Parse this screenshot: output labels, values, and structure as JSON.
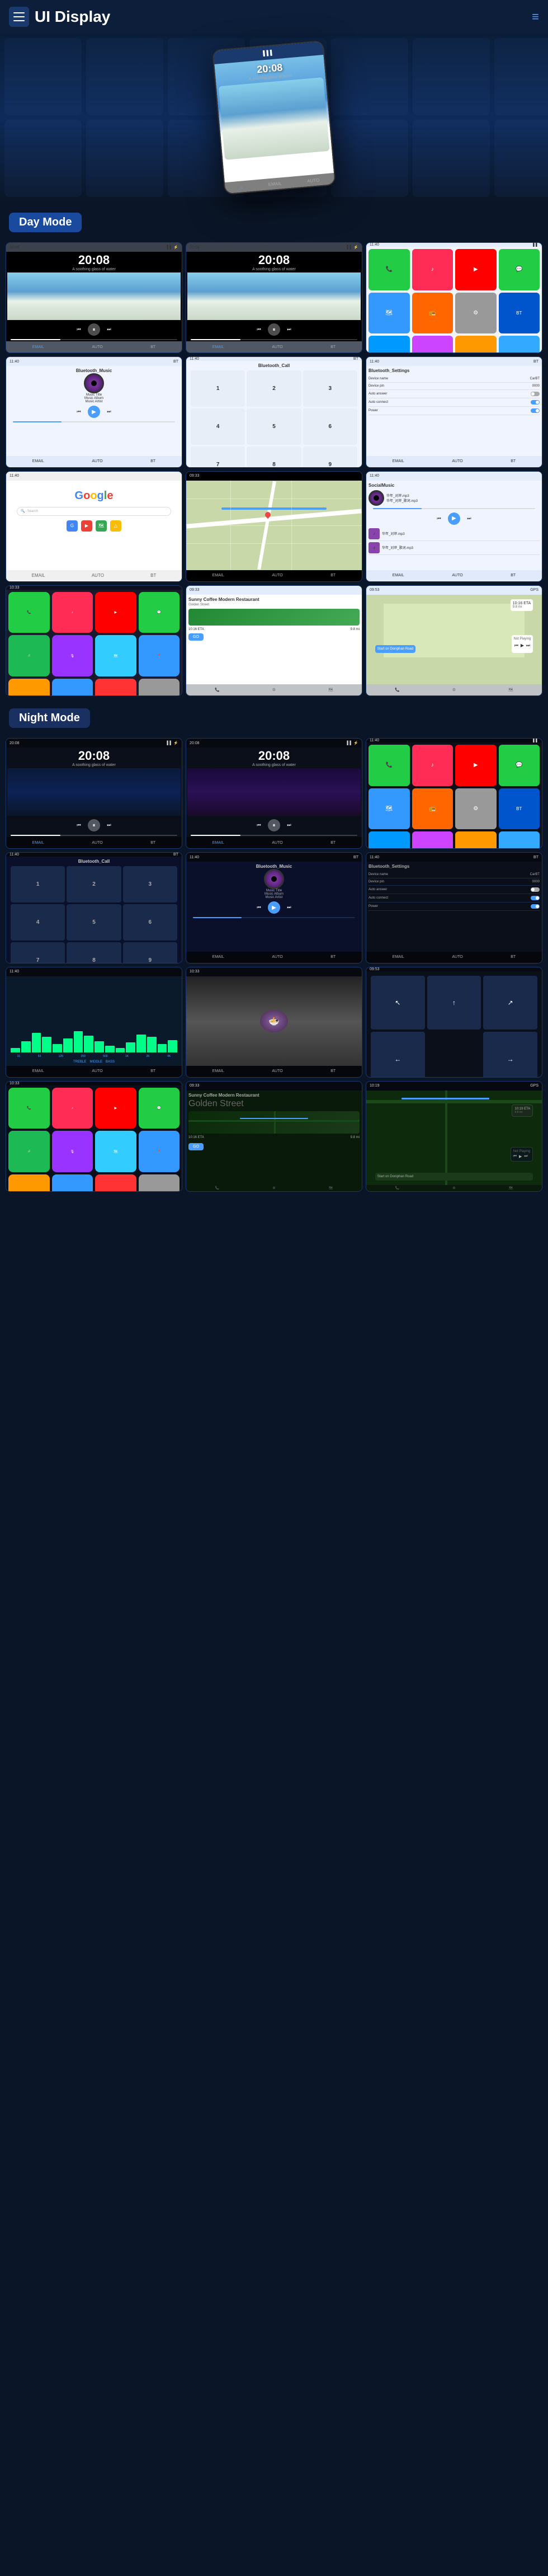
{
  "header": {
    "title": "UI Display",
    "menu_label": "Menu",
    "nav_icon": "≡"
  },
  "hero": {
    "device": {
      "time": "20:08",
      "subtitle": "A soothing glass of water"
    }
  },
  "day_mode": {
    "label": "Day Mode",
    "screens": [
      {
        "id": "day-music-1",
        "type": "music",
        "time": "20:08",
        "subtitle": "A soothing glass of water",
        "bg": "day"
      },
      {
        "id": "day-music-2",
        "type": "music",
        "time": "20:08",
        "subtitle": "A soothing glass of water",
        "bg": "day"
      },
      {
        "id": "day-apps",
        "type": "apps",
        "bg": "day"
      },
      {
        "id": "day-bt-music",
        "type": "bt-music",
        "title": "Bluetooth_Music",
        "track": "Music Title",
        "album": "Music Album",
        "artist": "Music Artist"
      },
      {
        "id": "day-bt-call",
        "type": "bt-call",
        "title": "Bluetooth_Call"
      },
      {
        "id": "day-bt-settings",
        "type": "bt-settings",
        "title": "Bluetooth_Settings",
        "device_name_label": "Device name",
        "device_name_val": "CarBT",
        "device_pin_label": "Device pin",
        "device_pin_val": "0000",
        "auto_answer": "Auto answer",
        "auto_connect": "Auto connect",
        "power": "Power"
      },
      {
        "id": "day-google",
        "type": "google"
      },
      {
        "id": "day-map",
        "type": "map"
      },
      {
        "id": "day-local-music",
        "type": "local-music",
        "title": "SocialMusic"
      },
      {
        "id": "day-carplay",
        "type": "carplay"
      },
      {
        "id": "day-nav",
        "type": "navigation",
        "restaurant": "Sunny Coffee Modern Restaurant",
        "address": "Golden Street",
        "eta": "10:16 ETA",
        "distance": "9.8 mi"
      },
      {
        "id": "day-nav-2",
        "type": "navigation-2",
        "distance_label": "10:16 ETA",
        "start": "Start on Doniphan Road",
        "now_playing": "Not Playing"
      }
    ]
  },
  "night_mode": {
    "label": "Night Mode",
    "screens": [
      {
        "id": "night-music-1",
        "type": "music",
        "time": "20:08",
        "bg": "night"
      },
      {
        "id": "night-music-2",
        "type": "music",
        "time": "20:08",
        "bg": "purple"
      },
      {
        "id": "night-apps",
        "type": "apps",
        "bg": "night"
      },
      {
        "id": "night-bt-call",
        "type": "bt-call",
        "title": "Bluetooth_Call",
        "dark": true
      },
      {
        "id": "night-bt-music",
        "type": "bt-music",
        "title": "Bluetooth_Music",
        "track": "Music Title",
        "album": "Music Album",
        "artist": "Music Artist",
        "dark": true
      },
      {
        "id": "night-bt-settings",
        "type": "bt-settings",
        "title": "Bluetooth_Settings",
        "device_name_label": "Device name",
        "device_name_val": "CarBT",
        "device_pin_label": "Device pin",
        "device_pin_val": "0000",
        "auto_answer": "Auto answer",
        "auto_connect": "Auto connect",
        "power": "Power",
        "dark": true
      },
      {
        "id": "night-eq",
        "type": "eq",
        "bars": [
          3,
          8,
          15,
          25,
          35,
          28,
          20,
          30,
          22,
          18,
          12,
          8,
          20,
          32,
          28,
          15
        ]
      },
      {
        "id": "night-food",
        "type": "food-photo"
      },
      {
        "id": "night-nav-arrows",
        "type": "nav-arrows"
      },
      {
        "id": "night-carplay",
        "type": "carplay",
        "dark": true
      },
      {
        "id": "night-map",
        "type": "map-restaurant",
        "restaurant": "Sunny Coffee Modern Restaurant",
        "address": "Golden Street"
      },
      {
        "id": "night-nav-2",
        "type": "navigation-night",
        "eta": "10:19 ETA",
        "distance": "9.8 mi",
        "start": "Start on Doniphan Road",
        "now_playing": "Not Playing"
      }
    ]
  },
  "app_icons": [
    {
      "color": "#22cc44",
      "label": "📞"
    },
    {
      "color": "#ff2d55",
      "label": "♪"
    },
    {
      "color": "#ff0000",
      "label": "▶"
    },
    {
      "color": "#22cc44",
      "label": "💬"
    },
    {
      "color": "#3399ff",
      "label": "🗺"
    },
    {
      "color": "#ff9900",
      "label": "📷"
    },
    {
      "color": "#999",
      "label": "⚙"
    },
    {
      "color": "#0055cc",
      "label": "BT"
    },
    {
      "color": "#33aaff",
      "label": "☁"
    },
    {
      "color": "#cc44ff",
      "label": "📺"
    },
    {
      "color": "#1db954",
      "label": "♫"
    },
    {
      "color": "#9933ff",
      "label": "🎙"
    }
  ]
}
